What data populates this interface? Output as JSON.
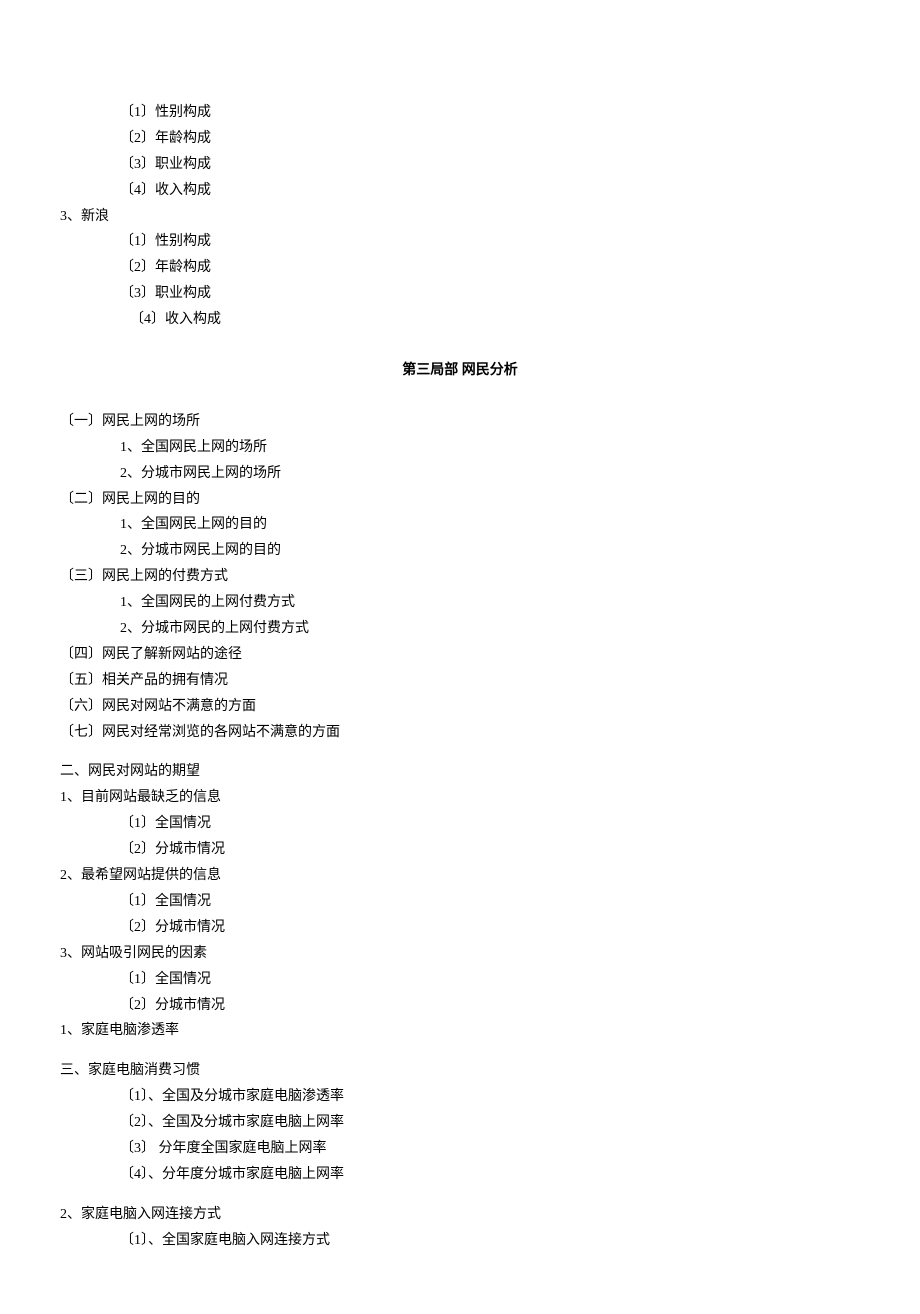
{
  "block1": {
    "items": [
      "〔1〕性别构成",
      "〔2〕年龄构成",
      "〔3〕职业构成",
      "〔4〕收入构成"
    ]
  },
  "item3": "3、新浪",
  "block2": {
    "items": [
      "〔1〕性别构成",
      "〔2〕年龄构成",
      "〔3〕职业构成",
      "〔4〕收入构成"
    ]
  },
  "section_title": "第三局部  网民分析",
  "sec1": {
    "h1": "〔一〕网民上网的场所",
    "i1": "1、全国网民上网的场所",
    "i2": "2、分城市网民上网的场所",
    "h2": "〔二〕网民上网的目的",
    "i3": "1、全国网民上网的目的",
    "i4": "2、分城市网民上网的目的",
    "h3": "〔三〕网民上网的付费方式",
    "i5": "1、全国网民的上网付费方式",
    "i6": "2、分城市网民的上网付费方式",
    "h4": "〔四〕网民了解新网站的途径",
    "h5": "〔五〕相关产品的拥有情况",
    "h6": "〔六〕网民对网站不满意的方面",
    "h7": "〔七〕网民对经常浏览的各网站不满意的方面"
  },
  "sec2": {
    "title": "二、网民对网站的期望",
    "g1": "1、目前网站最缺乏的信息",
    "g1a": "〔1〕全国情况",
    "g1b": "〔2〕分城市情况",
    "g2": "2、最希望网站提供的信息",
    "g2a": "〔1〕全国情况",
    "g2b": "〔2〕分城市情况",
    "g3": "3、网站吸引网民的因素",
    "g3a": "〔1〕全国情况",
    "g3b": "〔2〕分城市情况",
    "g4": "1、家庭电脑渗透率"
  },
  "sec3": {
    "title": "三、家庭电脑消费习惯",
    "i1": "〔1〕、全国及分城市家庭电脑渗透率",
    "i2": "〔2〕、全国及分城市家庭电脑上网率",
    "i3": "〔3〕    分年度全国家庭电脑上网率",
    "i4": "〔4〕、分年度分城市家庭电脑上网率",
    "g2": "2、家庭电脑入网连接方式",
    "g2a": "〔1〕、全国家庭电脑入网连接方式"
  }
}
